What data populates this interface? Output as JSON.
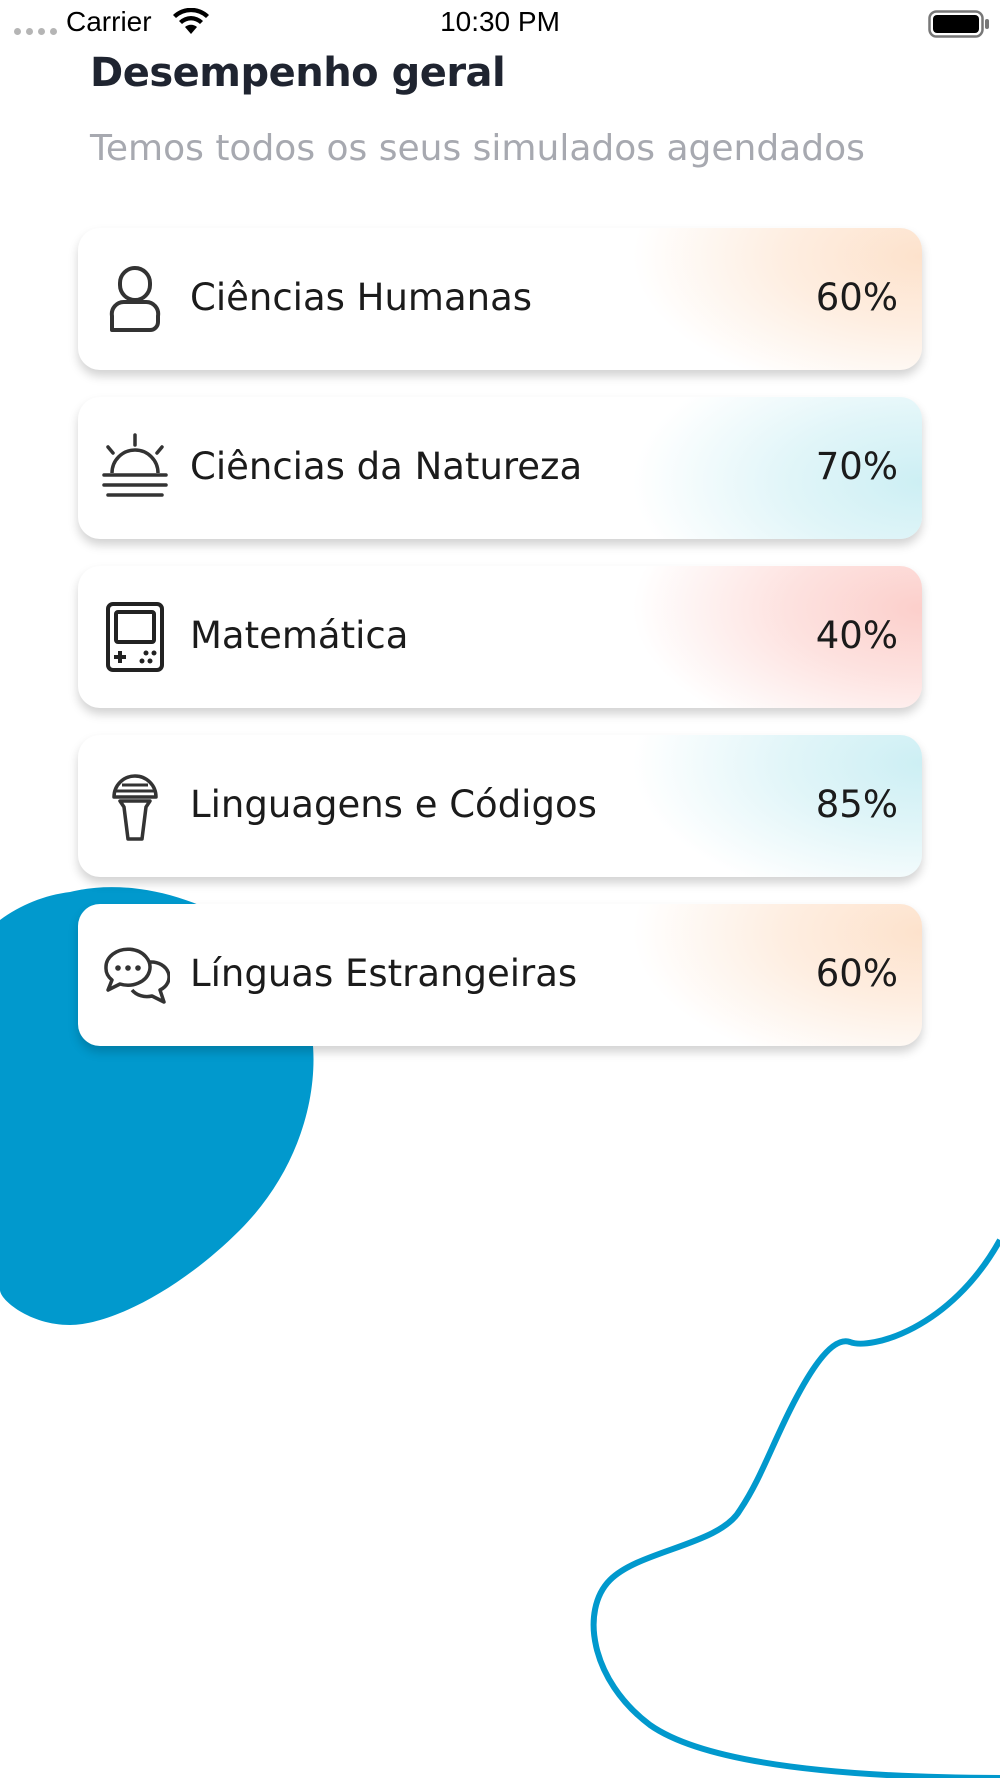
{
  "status_bar": {
    "carrier": "Carrier",
    "time": "10:30 PM"
  },
  "header": {
    "title": "Desempenho geral",
    "subtitle": "Temos todos os seus simulados agendados"
  },
  "colors": {
    "accent_blue": "#0199cd",
    "tint_orange": "#fde2cc",
    "tint_cyan": "#cdeff4",
    "tint_red": "#fccfcb"
  },
  "subjects": [
    {
      "name": "Ciências Humanas",
      "value": "60%",
      "icon": "person-icon",
      "tint": "orange"
    },
    {
      "name": "Ciências da Natureza",
      "value": "70%",
      "icon": "sunrise-icon",
      "tint": "cyan"
    },
    {
      "name": "Matemática",
      "value": "40%",
      "icon": "gameboy-icon",
      "tint": "red"
    },
    {
      "name": "Linguagens e Códigos",
      "value": "85%",
      "icon": "microphone-icon",
      "tint": "cyan"
    },
    {
      "name": "Línguas Estrangeiras",
      "value": "60%",
      "icon": "chat-bubbles-icon",
      "tint": "orange"
    }
  ]
}
